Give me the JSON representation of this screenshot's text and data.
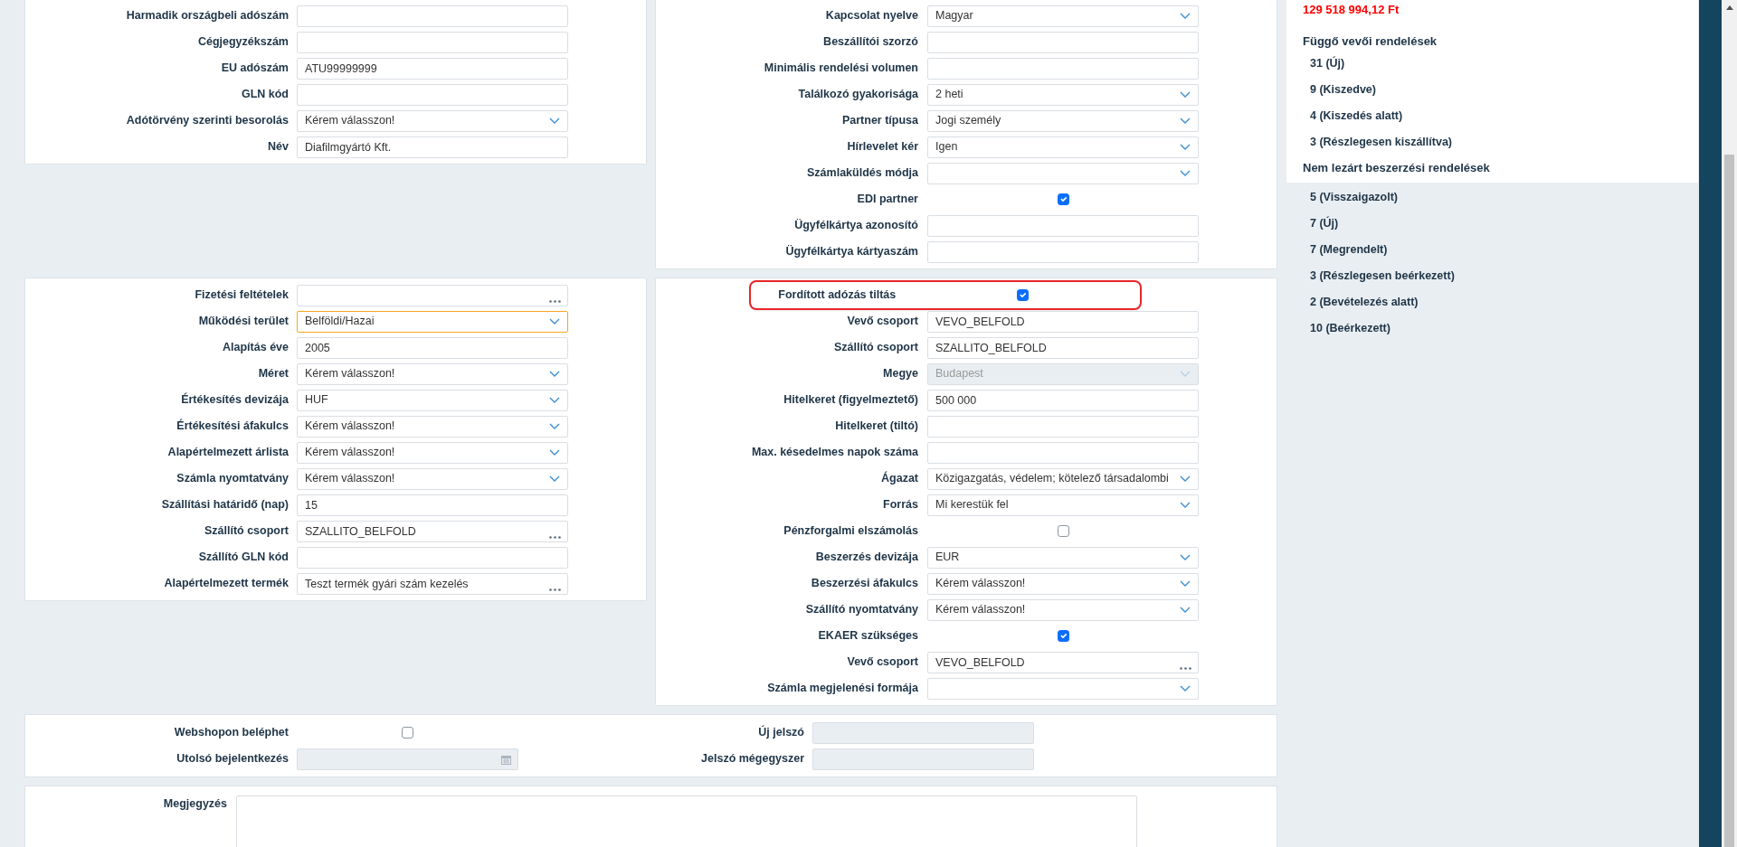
{
  "sections": [
    {
      "kind": "pair",
      "left": {
        "fields": [
          {
            "kind": "text",
            "label": "Harmadik országbeli adószám"
          },
          {
            "kind": "text",
            "label": "Cégjegyzékszám"
          },
          {
            "kind": "text",
            "label": "EU adószám",
            "value": "ATU99999999"
          },
          {
            "kind": "text",
            "label": "GLN kód"
          },
          {
            "kind": "select",
            "label": "Adótörvény szerinti besorolás",
            "value": "Kérem válasszon!"
          },
          {
            "kind": "text",
            "label": "Név",
            "value": "Diafilmgyártó Kft."
          }
        ]
      },
      "right": {
        "fields": [
          {
            "kind": "select",
            "label": "Kapcsolat nyelve",
            "value": "Magyar"
          },
          {
            "kind": "text",
            "label": "Beszállítói szorzó"
          },
          {
            "kind": "text",
            "label": "Minimális rendelési volumen"
          },
          {
            "kind": "select",
            "label": "Találkozó gyakorisága",
            "value": "2 heti"
          },
          {
            "kind": "select",
            "label": "Partner típusa",
            "value": "Jogi személy"
          },
          {
            "kind": "select",
            "label": "Hírlevelet kér",
            "value": "Igen"
          },
          {
            "kind": "select",
            "label": "Számlaküldés módja"
          },
          {
            "kind": "checkbox",
            "label": "EDI partner",
            "checked": true
          },
          {
            "kind": "text",
            "label": "Ügyfélkártya azonosító"
          },
          {
            "kind": "text",
            "label": "Ügyfélkártya kártyaszám"
          }
        ]
      }
    },
    {
      "kind": "pair",
      "left": {
        "fields": [
          {
            "kind": "lookup",
            "label": "Fizetési feltételek",
            "focused": false
          },
          {
            "kind": "select",
            "label": "Működési terület",
            "value": "Belföldi/Hazai",
            "focused": true
          },
          {
            "kind": "text",
            "label": "Alapítás éve",
            "value": "2005",
            "focused": false
          },
          {
            "kind": "select",
            "label": "Méret",
            "value": "Kérem válasszon!",
            "focused": false
          },
          {
            "kind": "select",
            "label": "Értékesítés devizája",
            "value": "HUF",
            "focused": false
          },
          {
            "kind": "select",
            "label": "Értékesítési áfakulcs",
            "value": "Kérem válasszon!",
            "focused": false
          },
          {
            "kind": "select",
            "label": "Alapértelmezett árlista",
            "value": "Kérem válasszon!",
            "focused": false
          },
          {
            "kind": "select",
            "label": "Számla nyomtatvány",
            "value": "Kérem válasszon!",
            "focused": false
          },
          {
            "kind": "text",
            "label": "Szállítási határidő (nap)",
            "value": "15",
            "focused": false
          },
          {
            "kind": "lookup",
            "label": "Szállító csoport",
            "value": "SZALLITO_BELFOLD",
            "focused": false
          },
          {
            "kind": "text",
            "label": "Szállító GLN kód",
            "focused": false
          },
          {
            "kind": "lookup",
            "label": "Alapértelmezett termék",
            "value": "Teszt termék gyári szám kezelés",
            "focused": false
          }
        ]
      },
      "right": {
        "fields": [
          {
            "kind": "checkbox",
            "label": "Fordított adózás tiltás",
            "checked": true,
            "highlighted": true
          },
          {
            "kind": "text",
            "label": "Vevő csoport",
            "value": "VEVO_BELFOLD",
            "highlighted": false
          },
          {
            "kind": "text",
            "label": "Szállító csoport",
            "value": "SZALLITO_BELFOLD",
            "highlighted": false
          },
          {
            "kind": "select",
            "label": "Megye",
            "value": "Budapest",
            "disabled": true,
            "highlighted": false
          },
          {
            "kind": "text",
            "label": "Hitelkeret (figyelmeztető)",
            "value": "500 000",
            "highlighted": false
          },
          {
            "kind": "text",
            "label": "Hitelkeret (tiltó)",
            "highlighted": false
          },
          {
            "kind": "text",
            "label": "Max. késedelmes napok száma",
            "highlighted": false
          },
          {
            "kind": "select",
            "label": "Ágazat",
            "value": "Közigazgatás, védelem; kötelező társadalombi",
            "highlighted": false
          },
          {
            "kind": "select",
            "label": "Forrás",
            "value": "Mi kerestük fel",
            "highlighted": false
          },
          {
            "kind": "checkbox",
            "label": "Pénzforgalmi elszámolás",
            "checked": false,
            "highlighted": false
          },
          {
            "kind": "select",
            "label": "Beszerzés devizája",
            "value": "EUR",
            "highlighted": false
          },
          {
            "kind": "select",
            "label": "Beszerzési áfakulcs",
            "value": "Kérem válasszon!",
            "highlighted": false
          },
          {
            "kind": "select",
            "label": "Szállító nyomtatvány",
            "value": "Kérem válasszon!",
            "highlighted": false
          },
          {
            "kind": "checkbox",
            "label": "EKAER szükséges",
            "checked": true,
            "highlighted": false
          },
          {
            "kind": "lookup",
            "label": "Vevő csoport",
            "value": "VEVO_BELFOLD",
            "highlighted": false
          },
          {
            "kind": "select",
            "label": "Számla megjelenési formája",
            "highlighted": false
          }
        ]
      }
    },
    {
      "kind": "wide",
      "left": {
        "fields": [
          {
            "kind": "checkbox",
            "label": "Webshopon beléphet",
            "checked": false
          },
          {
            "kind": "date",
            "label": "Utolsó bejelentkezés",
            "disabled": true
          }
        ]
      },
      "right": {
        "fields": [
          {
            "kind": "text",
            "label": "Új jelszó",
            "disabled": true
          },
          {
            "kind": "text",
            "label": "Jelszó mégegyszer",
            "disabled": true
          }
        ]
      }
    },
    {
      "kind": "note",
      "label": "Megjegyzés"
    }
  ],
  "sidebar": {
    "balance": "129 518 994,12 Ft",
    "groups": [
      {
        "title": "Függő vevői rendelések",
        "items": [
          "31 (Új)",
          "9 (Kiszedve)",
          "4 (Kiszedés alatt)",
          "3 (Részlegesen kiszállítva)"
        ]
      },
      {
        "title": "Nem lezárt beszerzési rendelések",
        "items": [
          "5 (Visszaigazolt)",
          "7 (Új)",
          "7 (Megrendelt)",
          "3 (Részlegesen beérkezett)",
          "2 (Bevételezés alatt)",
          "10 (Beérkezett)"
        ]
      }
    ]
  }
}
